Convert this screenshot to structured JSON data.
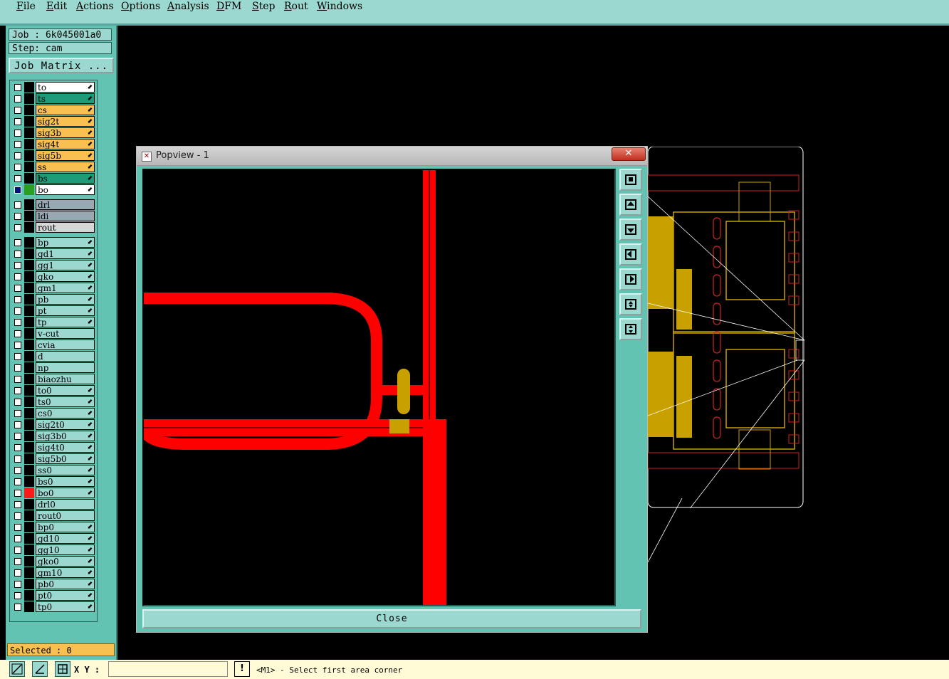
{
  "menu": [
    "File",
    "Edit",
    "Actions",
    "Options",
    "Analysis",
    "DFM",
    "Step",
    "Rout",
    "Windows"
  ],
  "job": {
    "label": "Job : 6k045001a0",
    "step": "Step: cam",
    "matrix_button": "Job Matrix ..."
  },
  "layers": [
    {
      "name": "to",
      "color": "#ffffff",
      "arrow": true
    },
    {
      "name": "ts",
      "color": "#1e9c7a",
      "arrow": true
    },
    {
      "name": "cs",
      "color": "#f8c050",
      "arrow": true
    },
    {
      "name": "sig2t",
      "color": "#f8c050",
      "arrow": true
    },
    {
      "name": "sig3b",
      "color": "#f8c050",
      "arrow": true
    },
    {
      "name": "sig4t",
      "color": "#f8c050",
      "arrow": true
    },
    {
      "name": "sig5b",
      "color": "#f8c050",
      "arrow": true
    },
    {
      "name": "ss",
      "color": "#f8c050",
      "arrow": true
    },
    {
      "name": "bs",
      "color": "#1e9c7a",
      "arrow": true
    },
    {
      "name": "bo",
      "color": "#ffffff",
      "arrow": true,
      "checked": true,
      "swatch": "#2aa020"
    },
    {
      "name": "drl",
      "color": "#9aa8b4",
      "arrow": false,
      "gap": true
    },
    {
      "name": "ldi",
      "color": "#9aa8b4",
      "arrow": false
    },
    {
      "name": "rout",
      "color": "#d6d6d6",
      "arrow": false
    },
    {
      "name": "bp",
      "color": "#9bd8d0",
      "arrow": true,
      "gap": true
    },
    {
      "name": "gd1",
      "color": "#9bd8d0",
      "arrow": true
    },
    {
      "name": "gg1",
      "color": "#9bd8d0",
      "arrow": true
    },
    {
      "name": "gko",
      "color": "#9bd8d0",
      "arrow": true
    },
    {
      "name": "gm1",
      "color": "#9bd8d0",
      "arrow": true
    },
    {
      "name": "pb",
      "color": "#9bd8d0",
      "arrow": true
    },
    {
      "name": "pt",
      "color": "#9bd8d0",
      "arrow": true
    },
    {
      "name": "tp",
      "color": "#9bd8d0",
      "arrow": true
    },
    {
      "name": "v-cut",
      "color": "#9bd8d0",
      "arrow": false
    },
    {
      "name": "cvia",
      "color": "#9bd8d0",
      "arrow": false
    },
    {
      "name": "d",
      "color": "#9bd8d0",
      "arrow": false
    },
    {
      "name": "np",
      "color": "#9bd8d0",
      "arrow": false
    },
    {
      "name": "biaozhu",
      "color": "#9bd8d0",
      "arrow": false
    },
    {
      "name": "to0",
      "color": "#9bd8d0",
      "arrow": true
    },
    {
      "name": "ts0",
      "color": "#9bd8d0",
      "arrow": true
    },
    {
      "name": "cs0",
      "color": "#9bd8d0",
      "arrow": true
    },
    {
      "name": "sig2t0",
      "color": "#9bd8d0",
      "arrow": true
    },
    {
      "name": "sig3b0",
      "color": "#9bd8d0",
      "arrow": true
    },
    {
      "name": "sig4t0",
      "color": "#9bd8d0",
      "arrow": true
    },
    {
      "name": "sig5b0",
      "color": "#9bd8d0",
      "arrow": true
    },
    {
      "name": "ss0",
      "color": "#9bd8d0",
      "arrow": true
    },
    {
      "name": "bs0",
      "color": "#9bd8d0",
      "arrow": true
    },
    {
      "name": "bo0",
      "color": "#9bd8d0",
      "arrow": true,
      "swatch": "#ff1a1a"
    },
    {
      "name": "drl0",
      "color": "#9bd8d0",
      "arrow": false
    },
    {
      "name": "rout0",
      "color": "#9bd8d0",
      "arrow": false
    },
    {
      "name": "bp0",
      "color": "#9bd8d0",
      "arrow": true
    },
    {
      "name": "gd10",
      "color": "#9bd8d0",
      "arrow": true
    },
    {
      "name": "gg10",
      "color": "#9bd8d0",
      "arrow": true
    },
    {
      "name": "gko0",
      "color": "#9bd8d0",
      "arrow": true
    },
    {
      "name": "gm10",
      "color": "#9bd8d0",
      "arrow": true
    },
    {
      "name": "pb0",
      "color": "#9bd8d0",
      "arrow": true
    },
    {
      "name": "pt0",
      "color": "#9bd8d0",
      "arrow": true
    },
    {
      "name": "tp0",
      "color": "#9bd8d0",
      "arrow": true
    }
  ],
  "selected": "Selected : 0",
  "status": {
    "xy_label": "X Y :",
    "xy_value": "",
    "message": "<M1> - Select first area corner"
  },
  "popview": {
    "title": "Popview - 1",
    "close_label": "Close"
  },
  "colors": {
    "trace": "#ff0000",
    "pad": "#c8a000",
    "board_outline": "#ffffff",
    "menu_bg": "#9bd8d0",
    "panel_bg": "#62c3b3"
  }
}
